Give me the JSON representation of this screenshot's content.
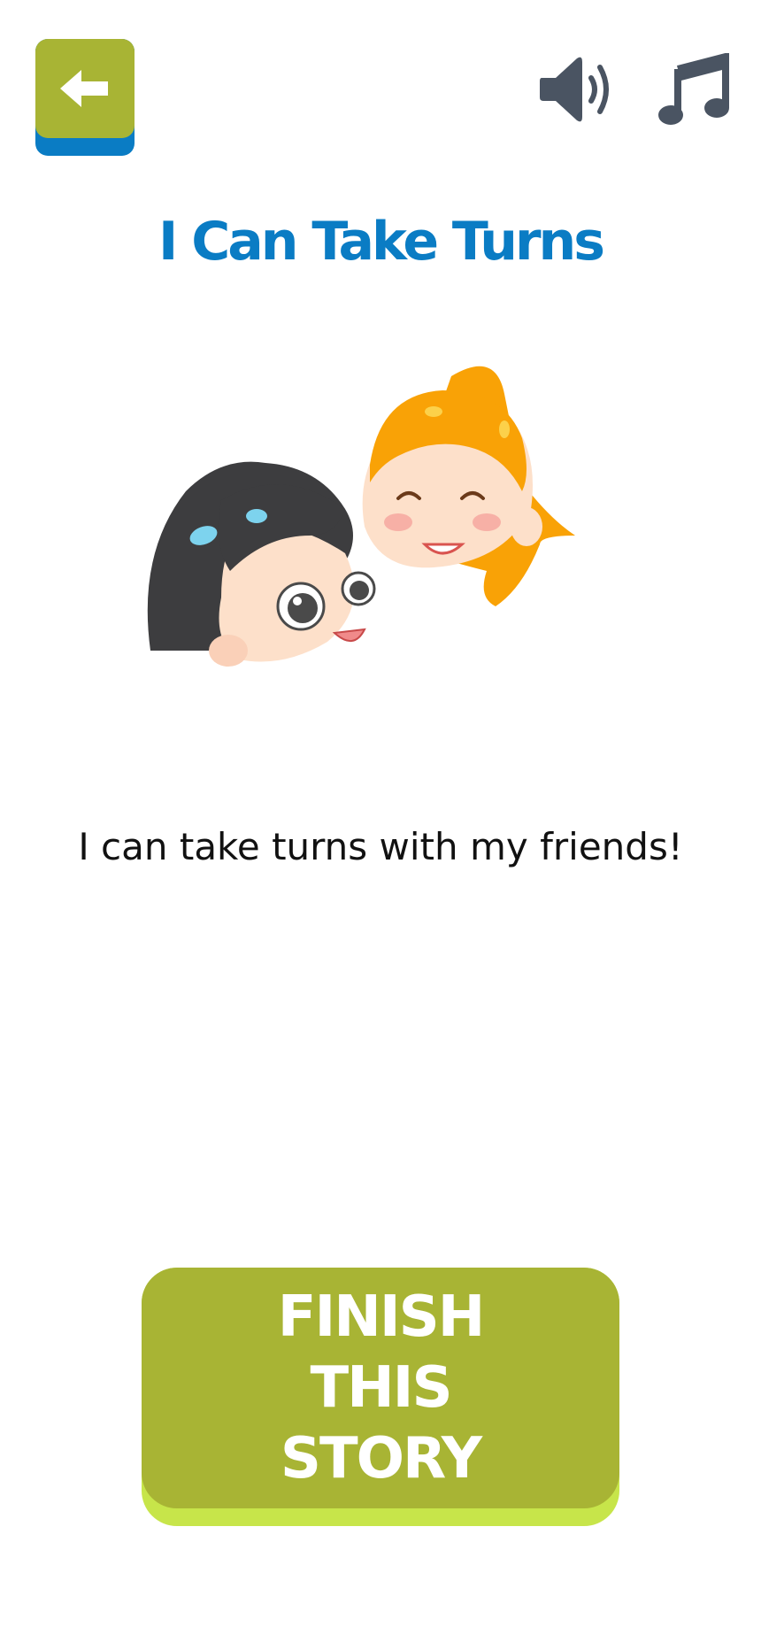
{
  "header": {
    "back_icon": "arrow-left-icon",
    "sound_icon": "speaker-volume-icon",
    "music_icon": "music-note-icon"
  },
  "story": {
    "title": "I Can Take Turns",
    "text": "I can take turns with my friends!",
    "illustration": "two-children-faces"
  },
  "actions": {
    "finish_label": "FINISH THIS STORY"
  },
  "colors": {
    "primary_blue": "#0a7cc4",
    "olive_green": "#a8b434",
    "lime_accent": "#c7e54a",
    "icon_gray": "#4a5462"
  }
}
